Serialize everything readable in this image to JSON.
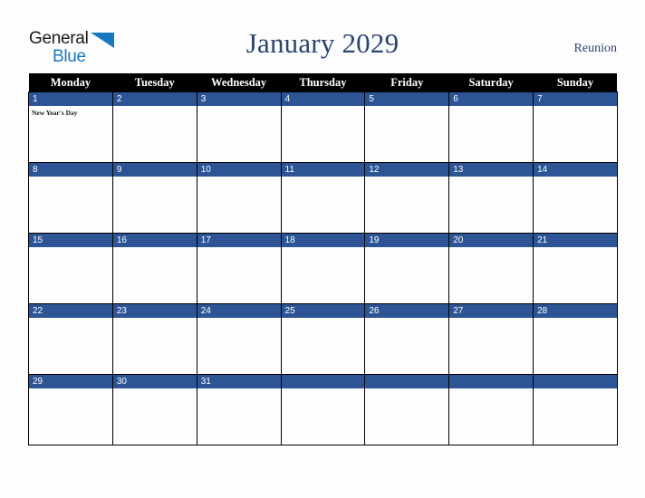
{
  "logo": {
    "word_one": "General",
    "word_two": "Blue",
    "triangle_icon": "triangle-icon",
    "brand_blue": "#1878be"
  },
  "header": {
    "title": "January 2029",
    "country": "Reunion",
    "title_color": "#2b4470"
  },
  "calendar": {
    "accent_blue": "#2d5494",
    "header_bg": "#000000",
    "weekday_headers": [
      "Monday",
      "Tuesday",
      "Wednesday",
      "Thursday",
      "Friday",
      "Saturday",
      "Sunday"
    ],
    "weeks": [
      [
        {
          "day": "1",
          "events": [
            "New Year's Day"
          ],
          "filled": true
        },
        {
          "day": "2",
          "events": [],
          "filled": true
        },
        {
          "day": "3",
          "events": [],
          "filled": true
        },
        {
          "day": "4",
          "events": [],
          "filled": true
        },
        {
          "day": "5",
          "events": [],
          "filled": true
        },
        {
          "day": "6",
          "events": [],
          "filled": true
        },
        {
          "day": "7",
          "events": [],
          "filled": true
        }
      ],
      [
        {
          "day": "8",
          "events": [],
          "filled": true
        },
        {
          "day": "9",
          "events": [],
          "filled": true
        },
        {
          "day": "10",
          "events": [],
          "filled": true
        },
        {
          "day": "11",
          "events": [],
          "filled": true
        },
        {
          "day": "12",
          "events": [],
          "filled": true
        },
        {
          "day": "13",
          "events": [],
          "filled": true
        },
        {
          "day": "14",
          "events": [],
          "filled": true
        }
      ],
      [
        {
          "day": "15",
          "events": [],
          "filled": true
        },
        {
          "day": "16",
          "events": [],
          "filled": true
        },
        {
          "day": "17",
          "events": [],
          "filled": true
        },
        {
          "day": "18",
          "events": [],
          "filled": true
        },
        {
          "day": "19",
          "events": [],
          "filled": true
        },
        {
          "day": "20",
          "events": [],
          "filled": true
        },
        {
          "day": "21",
          "events": [],
          "filled": true
        }
      ],
      [
        {
          "day": "22",
          "events": [],
          "filled": true
        },
        {
          "day": "23",
          "events": [],
          "filled": true
        },
        {
          "day": "24",
          "events": [],
          "filled": true
        },
        {
          "day": "25",
          "events": [],
          "filled": true
        },
        {
          "day": "26",
          "events": [],
          "filled": true
        },
        {
          "day": "27",
          "events": [],
          "filled": true
        },
        {
          "day": "28",
          "events": [],
          "filled": true
        }
      ],
      [
        {
          "day": "29",
          "events": [],
          "filled": true
        },
        {
          "day": "30",
          "events": [],
          "filled": true
        },
        {
          "day": "31",
          "events": [],
          "filled": true
        },
        {
          "day": "",
          "events": [],
          "filled": true
        },
        {
          "day": "",
          "events": [],
          "filled": true
        },
        {
          "day": "",
          "events": [],
          "filled": true
        },
        {
          "day": "",
          "events": [],
          "filled": true
        }
      ]
    ]
  }
}
